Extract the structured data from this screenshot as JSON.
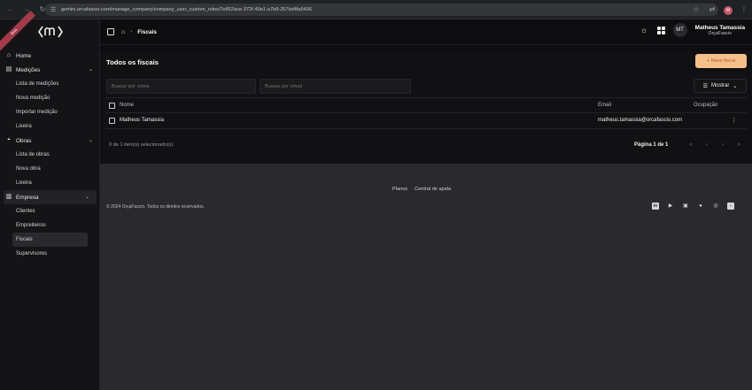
{
  "browser": {
    "url": "gemini.orcafascio.com/manage_company/company_user_custom_roles/7e852ace-372f-40e1-a7b8-257bd4fa9406",
    "profile_initial": "M"
  },
  "sidebar": {
    "ribbon_text": "Beta",
    "logo_text": "⟨m⟩",
    "items": [
      {
        "label": "Home",
        "icon": "home-icon"
      },
      {
        "label": "Medições",
        "icon": "clipboard-icon"
      },
      {
        "label": "Obras",
        "icon": "helmet-icon"
      },
      {
        "label": "Empresa",
        "icon": "building-icon"
      }
    ],
    "medicoes_sub": [
      "Lista de medições",
      "Nova medição",
      "Importar medição",
      "Lixeira"
    ],
    "obras_sub": [
      "Lista de obras",
      "Nova obra",
      "Lixeira"
    ],
    "empresa_sub": [
      "Clientes",
      "Empreiteiros",
      "Fiscais",
      "Supervisores"
    ]
  },
  "topbar": {
    "breadcrumb_current": "Fiscais",
    "avatar_initials": "MT",
    "user_name": "Matheus Tamassia",
    "company": "OrçaFascio"
  },
  "card": {
    "title": "Todos os fiscais",
    "new_button": "+ Novo fiscal",
    "search_name_placeholder": "Buscar por nome",
    "search_email_placeholder": "Buscar por email",
    "show_button": "Mostrar",
    "columns": {
      "name": "Nome",
      "email": "Email",
      "occupation": "Ocupação"
    },
    "rows": [
      {
        "name": "Matheus Tamassia",
        "email": "matheus.tamassia@orcafascio.com",
        "occupation": ""
      }
    ],
    "selected_text": "0 de 1 item(s) selecionado(s).",
    "page_info": "Página 1 de 1"
  },
  "footer": {
    "links": [
      "Planos",
      "Central de ajuda"
    ],
    "copyright": "© 2024 OrçaFascio. Todos os direitos reservados.",
    "socials": [
      "linkedin-icon",
      "spotify-icon",
      "youtube-icon",
      "facebook-icon",
      "instagram-icon",
      "tiktok-icon"
    ]
  },
  "colors": {
    "accent": "#f5c08c",
    "accent_text": "#b15b14",
    "background": "#0d0d0f",
    "sidebar": "#141416",
    "footer": "#2a2a2d"
  }
}
